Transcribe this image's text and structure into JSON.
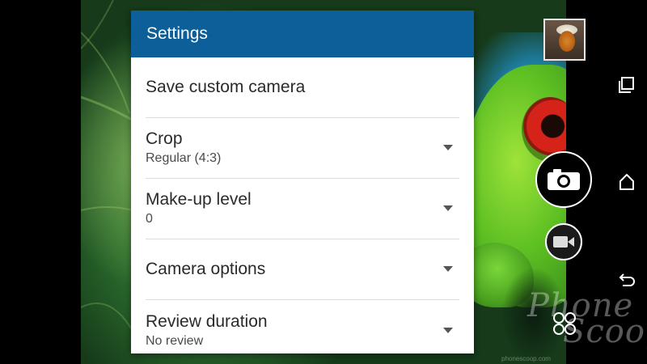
{
  "dialog": {
    "title": "Settings",
    "items": [
      {
        "label": "Save custom camera",
        "value": ""
      },
      {
        "label": "Crop",
        "value": "Regular (4:3)"
      },
      {
        "label": "Make-up level",
        "value": "0"
      },
      {
        "label": "Camera options",
        "value": ""
      },
      {
        "label": "Review duration",
        "value": "No review"
      }
    ]
  },
  "controls": {
    "thumbnail": "gallery-thumbnail",
    "shutter_icon": "camera-icon",
    "video_icon": "video-camera-icon",
    "modes_icon": "camera-modes-icon"
  },
  "navbar": {
    "recents_icon": "recent-apps-icon",
    "home_icon": "home-icon",
    "back_icon": "back-icon"
  },
  "watermark": {
    "text": "phone scoop",
    "line1": "Phone",
    "line2": "Scoop",
    "small": "phonescoop.com"
  },
  "colors": {
    "header": "#0c5f98",
    "dialog_bg": "#ffffff",
    "text": "#2a2a2a"
  }
}
